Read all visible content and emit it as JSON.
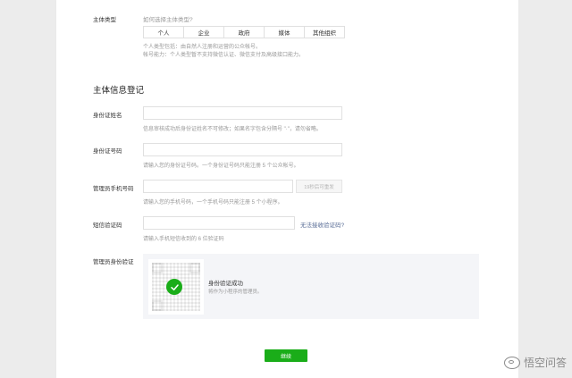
{
  "subject_type": {
    "label": "主体类型",
    "help_link": "如何选择主体类型?",
    "options": [
      "个人",
      "企业",
      "政府",
      "媒体",
      "其他组织"
    ],
    "desc_line1": "个人类型包括：由自然人注册和运营的公众帐号。",
    "desc_line2": "帐号能力：个人类型暂不支持微信认证、微信支付及高级接口能力。"
  },
  "section": {
    "title": "主体信息登记"
  },
  "id_name": {
    "label": "身份证姓名",
    "help": "信息审核成功后身份证姓名不可修改；如果名字包含分隔号 \"·\"，请勿省略。"
  },
  "id_number": {
    "label": "身份证号码",
    "help": "请输入您的身份证号码。一个身份证号码只能注册 5 个公众帐号。"
  },
  "admin_phone": {
    "label": "管理员手机号码",
    "help": "请输入您的手机号码，一个手机号码只能注册 5 个小程序。",
    "send_button": "19秒后可重发"
  },
  "sms_code": {
    "label": "短信验证码",
    "no_code_link": "无法接收验证码?",
    "help": "请输入手机短信收到的 6 位验证码"
  },
  "admin_verify": {
    "label": "管理员身份验证",
    "status_title": "身份验证成功",
    "status_desc": "将作为小程序的管理员。"
  },
  "footer": {
    "continue_button": "继续"
  },
  "watermark": {
    "text": "悟空问答"
  },
  "colors": {
    "primary_green": "#1aad19",
    "link_blue": "#576b95"
  }
}
